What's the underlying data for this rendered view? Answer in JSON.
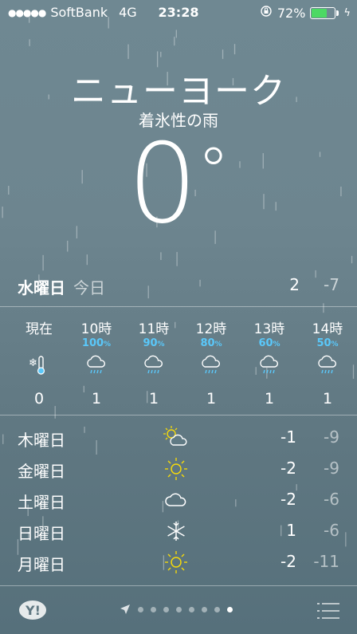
{
  "status": {
    "carrier": "SoftBank",
    "network": "4G",
    "time": "23:28",
    "battery": "72%",
    "battery_level": 0.72,
    "battery_color": "#4cd964"
  },
  "location": {
    "city": "ニューヨーク",
    "condition": "着氷性の雨",
    "temp": "0",
    "degree": "°"
  },
  "today": {
    "day": "水曜日",
    "label": "今日",
    "high": "2",
    "low": "-7"
  },
  "hourly": [
    {
      "time": "現在",
      "precip": "",
      "icon": "thermometer-snow-icon",
      "value": "0"
    },
    {
      "time": "10時",
      "precip": "100",
      "icon": "rain-cloud-icon",
      "value": "1"
    },
    {
      "time": "11時",
      "precip": "90",
      "icon": "rain-cloud-icon",
      "value": "1"
    },
    {
      "time": "12時",
      "precip": "80",
      "icon": "rain-cloud-icon",
      "value": "1"
    },
    {
      "time": "13時",
      "precip": "60",
      "icon": "rain-cloud-icon",
      "value": "1"
    },
    {
      "time": "14時",
      "precip": "50",
      "icon": "rain-cloud-icon",
      "value": "1"
    }
  ],
  "percent_sign": "%",
  "daily": [
    {
      "day": "木曜日",
      "icon": "partly-sunny-icon",
      "high": "-1",
      "low": "-9"
    },
    {
      "day": "金曜日",
      "icon": "sun-icon",
      "high": "-2",
      "low": "-9"
    },
    {
      "day": "土曜日",
      "icon": "cloud-icon",
      "high": "-2",
      "low": "-6"
    },
    {
      "day": "日曜日",
      "icon": "snowflake-icon",
      "high": "1",
      "low": "-6"
    },
    {
      "day": "月曜日",
      "icon": "sun-icon",
      "high": "-2",
      "low": "-11"
    }
  ],
  "footer": {
    "logo": "Y!",
    "pages": 8,
    "active_page": 8
  },
  "colors": {
    "accent_blue": "#5ac8fa",
    "sun_yellow": "#f5d90a"
  }
}
